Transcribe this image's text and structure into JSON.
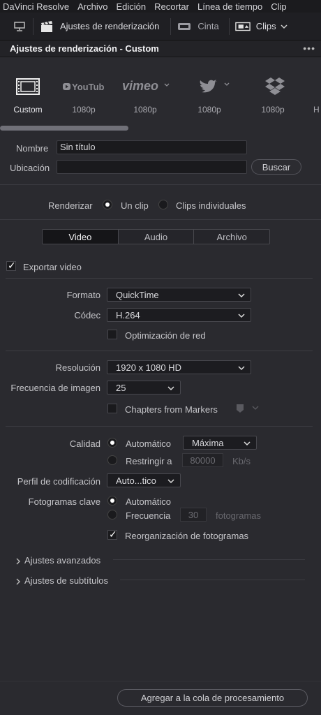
{
  "menu": [
    "DaVinci Resolve",
    "Archivo",
    "Edición",
    "Recortar",
    "Línea de tiempo",
    "Clip"
  ],
  "toolbar": {
    "render_settings_label": "Ajustes de renderización",
    "tape_label": "Cinta",
    "clips_label": "Clips"
  },
  "panel": {
    "title": "Ajustes de renderización - Custom",
    "more": "•••"
  },
  "presets": [
    {
      "name": "custom-icon",
      "label": "Custom"
    },
    {
      "name": "youtube-icon",
      "label": "1080p",
      "logo": "YouTube"
    },
    {
      "name": "vimeo-icon",
      "label": "1080p",
      "logo": "vimeo"
    },
    {
      "name": "twitter-icon",
      "label": "1080p"
    },
    {
      "name": "dropbox-icon",
      "label": "1080p"
    },
    {
      "name": "next-preset",
      "label": "H"
    }
  ],
  "location": {
    "name_label": "Nombre",
    "name_value": "Sin título",
    "location_label": "Ubicación",
    "location_value": "",
    "browse_label": "Buscar"
  },
  "render": {
    "label": "Renderizar",
    "single": "Un clip",
    "individual": "Clips individuales"
  },
  "tabs": [
    "Video",
    "Audio",
    "Archivo"
  ],
  "video": {
    "export_label": "Exportar video",
    "format_label": "Formato",
    "format_value": "QuickTime",
    "codec_label": "Códec",
    "codec_value": "H.264",
    "net_opt_label": "Optimización de red",
    "resolution_label": "Resolución",
    "resolution_value": "1920 x 1080 HD",
    "framerate_label": "Frecuencia de imagen",
    "framerate_value": "25",
    "chapters_label": "Chapters from Markers",
    "quality_label": "Calidad",
    "quality_auto": "Automático",
    "quality_value": "Máxima",
    "restrict_label": "Restringir a",
    "restrict_value": "80000",
    "restrict_unit": "Kb/s",
    "profile_label": "Perfil de codificación",
    "profile_value": "Auto...tico",
    "keyframes_label": "Fotogramas clave",
    "keyframes_auto": "Automático",
    "freq_label": "Frecuencia",
    "freq_value": "30",
    "freq_unit": "fotogramas",
    "reorder_label": "Reorganización de fotogramas"
  },
  "advanced": {
    "advanced_label": "Ajustes avanzados",
    "subtitles_label": "Ajustes de subtítulos"
  },
  "footer": {
    "queue_label": "Agregar a la cola de procesamiento"
  },
  "colors": {
    "bg": "#2a2a2f",
    "field": "#1a1a1d",
    "accent_white": "#ffffff"
  }
}
